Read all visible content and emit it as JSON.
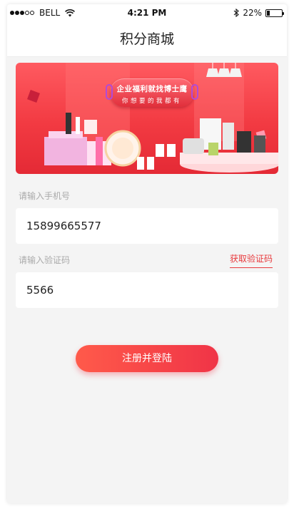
{
  "status_bar": {
    "carrier": "BELL",
    "time": "4:21 PM",
    "battery": "22%",
    "battery_level": 0.22
  },
  "nav": {
    "title": "积分商城"
  },
  "banner": {
    "headline": "企业福利就找博士鹰",
    "subline": "你想要的我都有"
  },
  "form": {
    "phone_label": "请输入手机号",
    "phone_value": "15899665577",
    "code_label": "请输入验证码",
    "get_code": "获取验证码",
    "code_value": "5566",
    "submit": "注册并登陆"
  },
  "colors": {
    "accent": "#e83a3d",
    "button_start": "#ff5a4a",
    "button_end": "#f03447",
    "background": "#f4f4f4"
  }
}
